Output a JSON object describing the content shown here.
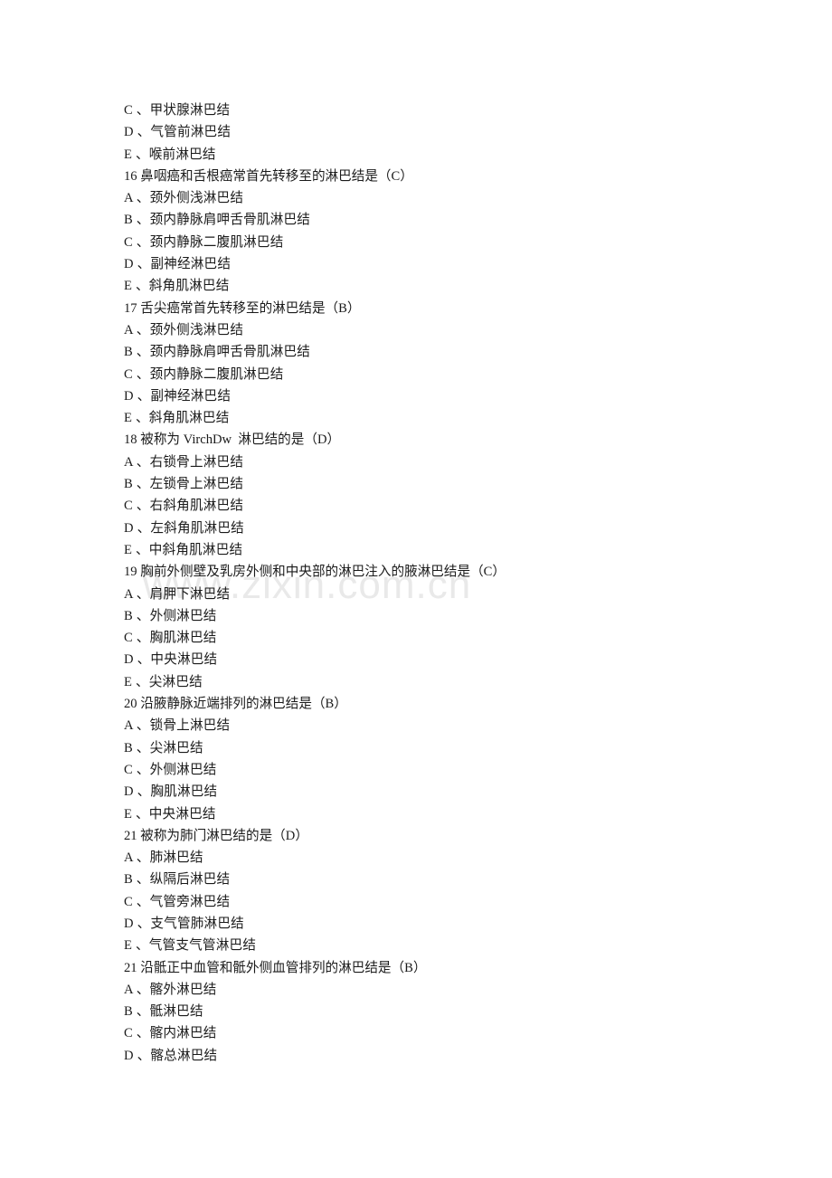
{
  "document": {
    "background_color": "#ffffff",
    "text_color": "#1a1a1a",
    "watermark": {
      "text": "www.zixin.com.cn",
      "color": "#e9e9e9"
    },
    "lines": [
      {
        "id": "l1",
        "type": "option",
        "text": "C 、甲状腺淋巴结"
      },
      {
        "id": "l2",
        "type": "option",
        "text": "D 、气管前淋巴结"
      },
      {
        "id": "l3",
        "type": "option",
        "text": "E 、喉前淋巴结"
      },
      {
        "id": "l4",
        "type": "question",
        "text": "16 鼻咽癌和舌根癌常首先转移至的淋巴结是（C）"
      },
      {
        "id": "l5",
        "type": "option",
        "text": "A 、颈外侧浅淋巴结"
      },
      {
        "id": "l6",
        "type": "option",
        "text": "B 、颈内静脉肩呷舌骨肌淋巴结"
      },
      {
        "id": "l7",
        "type": "option",
        "text": "C 、颈内静脉二腹肌淋巴结"
      },
      {
        "id": "l8",
        "type": "option",
        "text": "D 、副神经淋巴结"
      },
      {
        "id": "l9",
        "type": "option",
        "text": "E 、斜角肌淋巴结"
      },
      {
        "id": "l10",
        "type": "question",
        "text": "17 舌尖癌常首先转移至的淋巴结是（B）"
      },
      {
        "id": "l11",
        "type": "option",
        "text": "A 、颈外侧浅淋巴结"
      },
      {
        "id": "l12",
        "type": "option",
        "text": "B 、颈内静脉肩呷舌骨肌淋巴结"
      },
      {
        "id": "l13",
        "type": "option",
        "text": "C 、颈内静脉二腹肌淋巴结"
      },
      {
        "id": "l14",
        "type": "option",
        "text": "D 、副神经淋巴结"
      },
      {
        "id": "l15",
        "type": "option",
        "text": "E 、斜角肌淋巴结"
      },
      {
        "id": "l16",
        "type": "question",
        "text": "18 被称为 VirchDw  淋巴结的是（D）"
      },
      {
        "id": "l17",
        "type": "option",
        "text": "A 、右锁骨上淋巴结"
      },
      {
        "id": "l18",
        "type": "option",
        "text": "B 、左锁骨上淋巴结"
      },
      {
        "id": "l19",
        "type": "option",
        "text": "C 、右斜角肌淋巴结"
      },
      {
        "id": "l20",
        "type": "option",
        "text": "D 、左斜角肌淋巴结"
      },
      {
        "id": "l21",
        "type": "option",
        "text": "E 、中斜角肌淋巴结"
      },
      {
        "id": "l22",
        "type": "question",
        "text": "19 胸前外侧壁及乳房外侧和中央部的淋巴注入的腋淋巴结是（C）"
      },
      {
        "id": "l23",
        "type": "option",
        "text": "A 、肩胛下淋巴结"
      },
      {
        "id": "l24",
        "type": "option",
        "text": "B 、外侧淋巴结"
      },
      {
        "id": "l25",
        "type": "option",
        "text": "C 、胸肌淋巴结"
      },
      {
        "id": "l26",
        "type": "option",
        "text": "D 、中央淋巴结"
      },
      {
        "id": "l27",
        "type": "option",
        "text": "E 、尖淋巴结"
      },
      {
        "id": "l28",
        "type": "question",
        "text": "20 沿腋静脉近端排列的淋巴结是（B）"
      },
      {
        "id": "l29",
        "type": "option",
        "text": "A 、锁骨上淋巴结"
      },
      {
        "id": "l30",
        "type": "option",
        "text": "B 、尖淋巴结"
      },
      {
        "id": "l31",
        "type": "option",
        "text": "C 、外侧淋巴结"
      },
      {
        "id": "l32",
        "type": "option",
        "text": "D 、胸肌淋巴结"
      },
      {
        "id": "l33",
        "type": "option",
        "text": "E 、中央淋巴结"
      },
      {
        "id": "l34",
        "type": "question",
        "text": "21 被称为肺门淋巴结的是（D）"
      },
      {
        "id": "l35",
        "type": "option",
        "text": "A 、肺淋巴结"
      },
      {
        "id": "l36",
        "type": "option",
        "text": "B 、纵隔后淋巴结"
      },
      {
        "id": "l37",
        "type": "option",
        "text": "C 、气管旁淋巴结"
      },
      {
        "id": "l38",
        "type": "option",
        "text": "D 、支气管肺淋巴结"
      },
      {
        "id": "l39",
        "type": "option",
        "text": "E 、气管支气管淋巴结"
      },
      {
        "id": "l40",
        "type": "question",
        "text": "21 沿骶正中血管和骶外侧血管排列的淋巴结是（B）"
      },
      {
        "id": "l41",
        "type": "option",
        "text": "A 、髂外淋巴结"
      },
      {
        "id": "l42",
        "type": "option",
        "text": "B 、骶淋巴结"
      },
      {
        "id": "l43",
        "type": "option",
        "text": "C 、髂内淋巴结"
      },
      {
        "id": "l44",
        "type": "option",
        "text": "D 、髂总淋巴结"
      }
    ]
  }
}
